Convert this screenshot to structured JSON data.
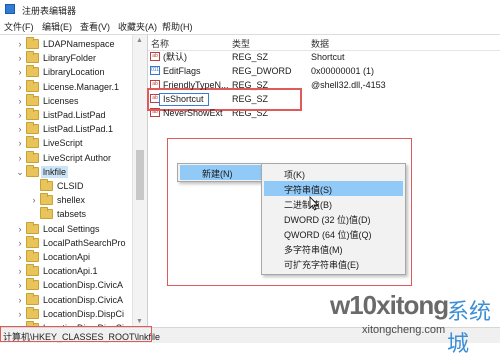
{
  "window": {
    "title": "注册表编辑器",
    "icon": "registry-editor-icon"
  },
  "menubar": [
    "文件(F)",
    "编辑(E)",
    "查看(V)",
    "收藏夹(A)",
    "帮助(H)"
  ],
  "tree": {
    "items": [
      {
        "label": "LDAPNamespace",
        "expandable": true
      },
      {
        "label": "LibraryFolder",
        "expandable": true
      },
      {
        "label": "LibraryLocation",
        "expandable": true
      },
      {
        "label": "License.Manager.1",
        "expandable": true
      },
      {
        "label": "Licenses",
        "expandable": true
      },
      {
        "label": "ListPad.ListPad",
        "expandable": true
      },
      {
        "label": "ListPad.ListPad.1",
        "expandable": true
      },
      {
        "label": "LiveScript",
        "expandable": true
      },
      {
        "label": "LiveScript Author",
        "expandable": true
      },
      {
        "label": "lnkfile",
        "expandable": true,
        "expanded": true,
        "selected": true
      },
      {
        "label": "CLSID",
        "expandable": false,
        "child": true
      },
      {
        "label": "shellex",
        "expandable": true,
        "child": true
      },
      {
        "label": "tabsets",
        "expandable": false,
        "child": true
      },
      {
        "label": "Local Settings",
        "expandable": true
      },
      {
        "label": "LocalPathSearchPro",
        "expandable": true
      },
      {
        "label": "LocationApi",
        "expandable": true
      },
      {
        "label": "LocationApi.1",
        "expandable": true
      },
      {
        "label": "LocationDisp.CivicA",
        "expandable": true
      },
      {
        "label": "LocationDisp.CivicA",
        "expandable": true
      },
      {
        "label": "LocationDisp.DispCi",
        "expandable": true
      },
      {
        "label": "LocationDisp.DispCi",
        "expandable": true
      }
    ]
  },
  "values_pane": {
    "columns": [
      "名称",
      "类型",
      "数据"
    ],
    "rows": [
      {
        "name": "(默认)",
        "type": "REG_SZ",
        "data": "Shortcut",
        "icon": "ab"
      },
      {
        "name": "EditFlags",
        "type": "REG_DWORD",
        "data": "0x00000001 (1)",
        "icon": "bin"
      },
      {
        "name": "FriendlyTypeN...",
        "type": "REG_SZ",
        "data": "@shell32.dll,-4153",
        "icon": "ab"
      },
      {
        "name": "IsShortcut",
        "type": "REG_SZ",
        "data": "",
        "icon": "ab",
        "editing": true
      },
      {
        "name": "NeverShowExt",
        "type": "REG_SZ",
        "data": "",
        "icon": "ab"
      }
    ]
  },
  "context_menu": {
    "items": [
      {
        "label": "新建(N)",
        "has_submenu": true,
        "highlighted": true
      }
    ]
  },
  "submenu": {
    "items": [
      {
        "label": "项(K)",
        "highlighted": false
      },
      {
        "label": "字符串值(S)",
        "highlighted": true
      },
      {
        "label": "二进制值(B)",
        "highlighted": false
      },
      {
        "label": "DWORD (32 位)值(D)",
        "highlighted": false
      },
      {
        "label": "QWORD (64 位)值(Q)",
        "highlighted": false
      },
      {
        "label": "多字符串值(M)",
        "highlighted": false
      },
      {
        "label": "可扩充字符串值(E)",
        "highlighted": false
      }
    ]
  },
  "statusbar": {
    "path": "计算机\\HKEY_CLASSES_ROOT\\lnkfile"
  },
  "watermark": {
    "main": "w10xitong",
    "accent": "系统城",
    "sub": "xitongcheng.com"
  },
  "colors": {
    "highlight": "#91c9f7",
    "selection": "#cce4f7",
    "annotation_red": "#e15a5a",
    "folder": "#e8c45a"
  }
}
